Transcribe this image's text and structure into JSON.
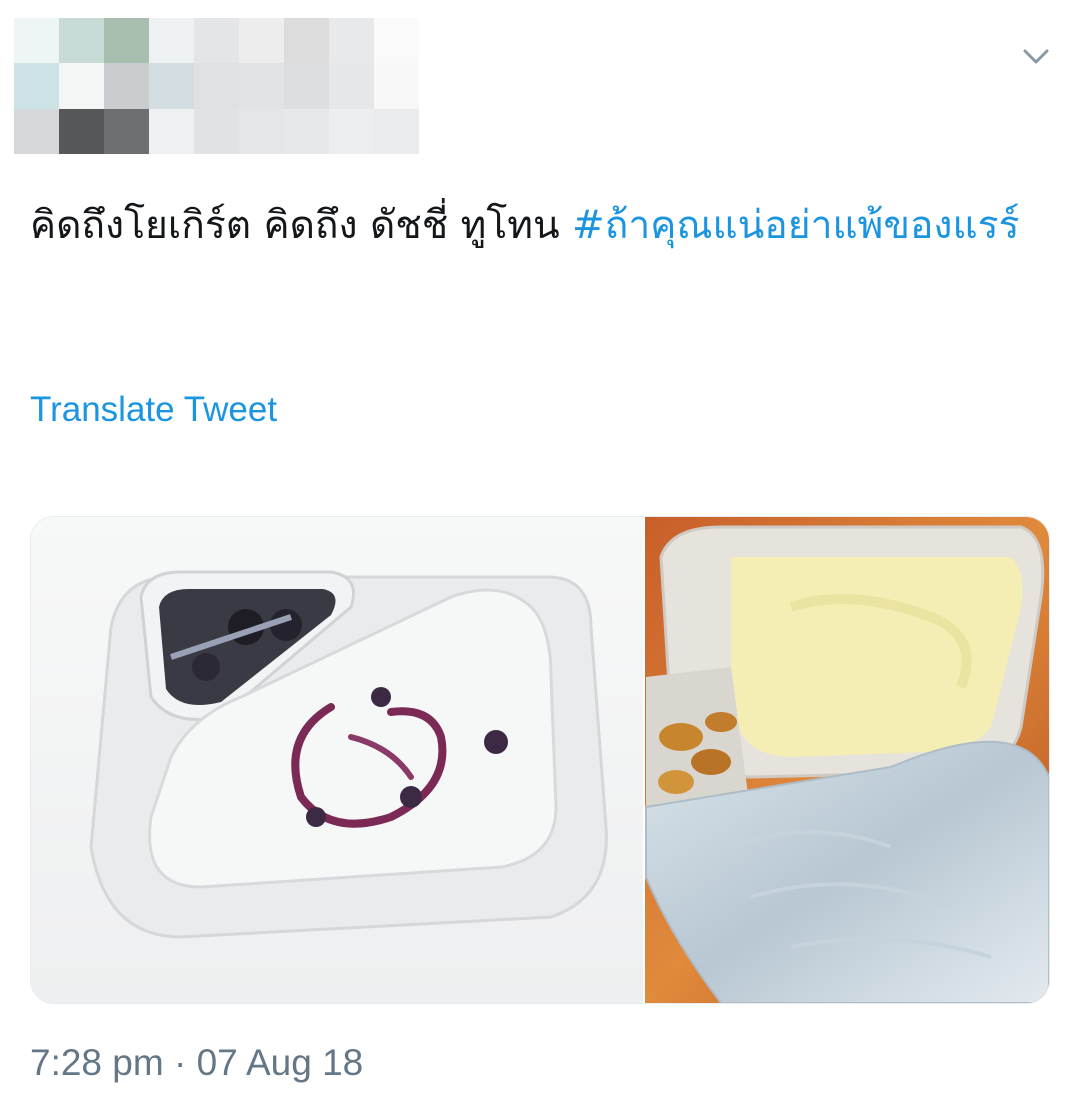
{
  "tweet": {
    "text_before": "คิดถึงโยเกิร์ต คิดถึง ดัชชี่ ทูโทน ",
    "hashtag": "#ถ้าคุณแน่อย่าแพ้ของแรร์",
    "translate_label": "Translate Tweet",
    "time": "7:28 pm",
    "separator": " · ",
    "date": "07 Aug 18"
  },
  "media": {
    "photos": [
      {
        "description_icon": "yogurt-cup-photo",
        "index": 1
      },
      {
        "description_icon": "opened-yogurt-cup-photo",
        "index": 2
      }
    ]
  },
  "icons": {
    "caret": "chevron-down-icon",
    "avatar": "blurred-avatar"
  },
  "colors": {
    "link": "#1b95e0",
    "text": "#14171a",
    "meta": "#657786",
    "border": "#e6ecf0"
  }
}
